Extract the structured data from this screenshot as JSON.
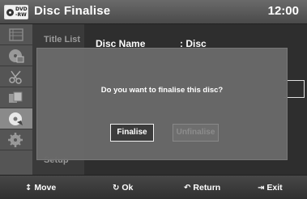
{
  "header": {
    "badge_line1": "DVD",
    "badge_line2": "-RW",
    "title": "Disc Finalise",
    "clock": "12:00"
  },
  "menu": {
    "title_list": "Title List",
    "setup": "Setup"
  },
  "content": {
    "disc_name_label": "Disc Name",
    "disc_name_value": ": Disc"
  },
  "dialog": {
    "message": "Do you want to finalise this disc?",
    "finalise_label": "Finalise",
    "unfinalise_label": "Unfinalise"
  },
  "footer": {
    "move_icon": "↕",
    "move_label": "Move",
    "ok_icon": "↻",
    "ok_label": "Ok",
    "return_icon": "↶",
    "return_label": "Return",
    "exit_icon": "⇥",
    "exit_label": "Exit"
  },
  "icons": {
    "sidebar": [
      "title-list-icon",
      "disc-manager-icon",
      "edit-scissors-icon",
      "copy-icon",
      "disc-settings-icon",
      "setup-gear-icon"
    ]
  },
  "colors": {
    "header": "#5a5a5a",
    "dialog": "#696969",
    "active_button_border": "#f2f2f2"
  }
}
